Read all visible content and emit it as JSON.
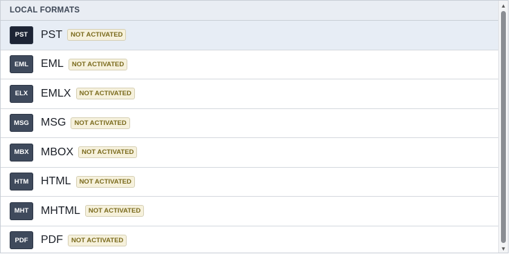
{
  "header": {
    "title": "LOCAL FORMATS"
  },
  "formats": [
    {
      "icon": "PST",
      "name": "PST",
      "status": "NOT ACTIVATED"
    },
    {
      "icon": "EML",
      "name": "EML",
      "status": "NOT ACTIVATED"
    },
    {
      "icon": "ELX",
      "name": "EMLX",
      "status": "NOT ACTIVATED"
    },
    {
      "icon": "MSG",
      "name": "MSG",
      "status": "NOT ACTIVATED"
    },
    {
      "icon": "MBX",
      "name": "MBOX",
      "status": "NOT ACTIVATED"
    },
    {
      "icon": "HTM",
      "name": "HTML",
      "status": "NOT ACTIVATED"
    },
    {
      "icon": "MHT",
      "name": "MHTML",
      "status": "NOT ACTIVATED"
    },
    {
      "icon": "PDF",
      "name": "PDF",
      "status": "NOT ACTIVATED"
    }
  ],
  "scrollbar": {
    "up_arrow": "▲",
    "down_arrow": "▼"
  },
  "colors": {
    "header_bg": "#e9edf3",
    "selected_bg": "#e7edf5",
    "icon_bg": "#3f4a5c",
    "status_text": "#7a6a1c"
  }
}
